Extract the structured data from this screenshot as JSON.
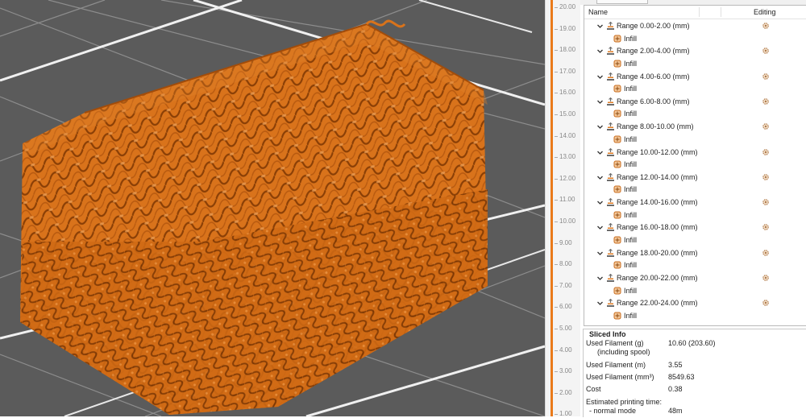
{
  "colors": {
    "filament": "#d9731b",
    "viewport_bg": "#5b5b5b",
    "ruler_track": "#ea7a1a"
  },
  "ruler": {
    "ticks": [
      "20.00",
      "19.00",
      "18.00",
      "17.00",
      "16.00",
      "15.00",
      "14.00",
      "13.00",
      "12.00",
      "11.00",
      "10.00",
      "9.00",
      "8.00",
      "7.00",
      "6.00",
      "5.00",
      "4.00",
      "3.00",
      "2.00",
      "1.00"
    ]
  },
  "object_list": {
    "col_name": "Name",
    "col_editing": "Editing",
    "ranges": [
      {
        "label": "Range 0.00-2.00 (mm)",
        "child": "Infill"
      },
      {
        "label": "Range 2.00-4.00 (mm)",
        "child": "Infill"
      },
      {
        "label": "Range 4.00-6.00 (mm)",
        "child": "Infill"
      },
      {
        "label": "Range 6.00-8.00 (mm)",
        "child": "Infill"
      },
      {
        "label": "Range 8.00-10.00 (mm)",
        "child": "Infill"
      },
      {
        "label": "Range 10.00-12.00 (mm)",
        "child": "Infill"
      },
      {
        "label": "Range 12.00-14.00 (mm)",
        "child": "Infill"
      },
      {
        "label": "Range 14.00-16.00 (mm)",
        "child": "Infill"
      },
      {
        "label": "Range 16.00-18.00 (mm)",
        "child": "Infill"
      },
      {
        "label": "Range 18.00-20.00 (mm)",
        "child": "Infill"
      },
      {
        "label": "Range 20.00-22.00 (mm)",
        "child": "Infill"
      },
      {
        "label": "Range 22.00-24.00 (mm)",
        "child": "Infill"
      }
    ]
  },
  "sliced_info": {
    "title": "Sliced Info",
    "used_filament_g_label": "Used Filament (g)",
    "including_spool_label": "(including spool)",
    "used_filament_g_value": "10.60 (203.60)",
    "used_filament_m_label": "Used Filament (m)",
    "used_filament_m_value": "3.55",
    "used_filament_mm3_label": "Used Filament (mm³)",
    "used_filament_mm3_value": "8549.63",
    "cost_label": "Cost",
    "cost_value": "0.38",
    "est_time_label": "Estimated printing time:",
    "normal_mode_label": "- normal mode",
    "normal_mode_value": "48m"
  }
}
